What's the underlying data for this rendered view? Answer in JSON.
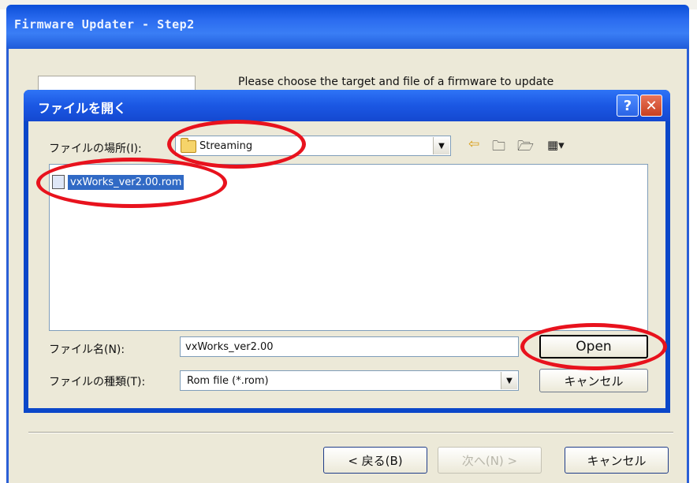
{
  "wizard": {
    "title": "Firmware Updater - Step2",
    "instruction": "Please choose the target and file of a firmware to update",
    "back_button": "< 戻る(B)",
    "next_button": "次へ(N) >",
    "cancel_button": "キャンセル"
  },
  "dialog": {
    "title": "ファイルを開く",
    "help_label": "?",
    "close_label": "✕",
    "location_label": "ファイルの場所(I):",
    "location_value": "Streaming",
    "files": [
      {
        "name": "vxWorks_ver2.00.rom",
        "selected": true
      }
    ],
    "filename_label": "ファイル名(N):",
    "filename_value": "vxWorks_ver2.00",
    "filetype_label": "ファイルの種類(T):",
    "filetype_value": "Rom file (*.rom)",
    "open_button": "Open",
    "cancel_button": "キャンセル"
  },
  "colors": {
    "highlight_ring": "#e8121d",
    "title_blue": "#2b6cf0",
    "selection": "#316ac5"
  }
}
